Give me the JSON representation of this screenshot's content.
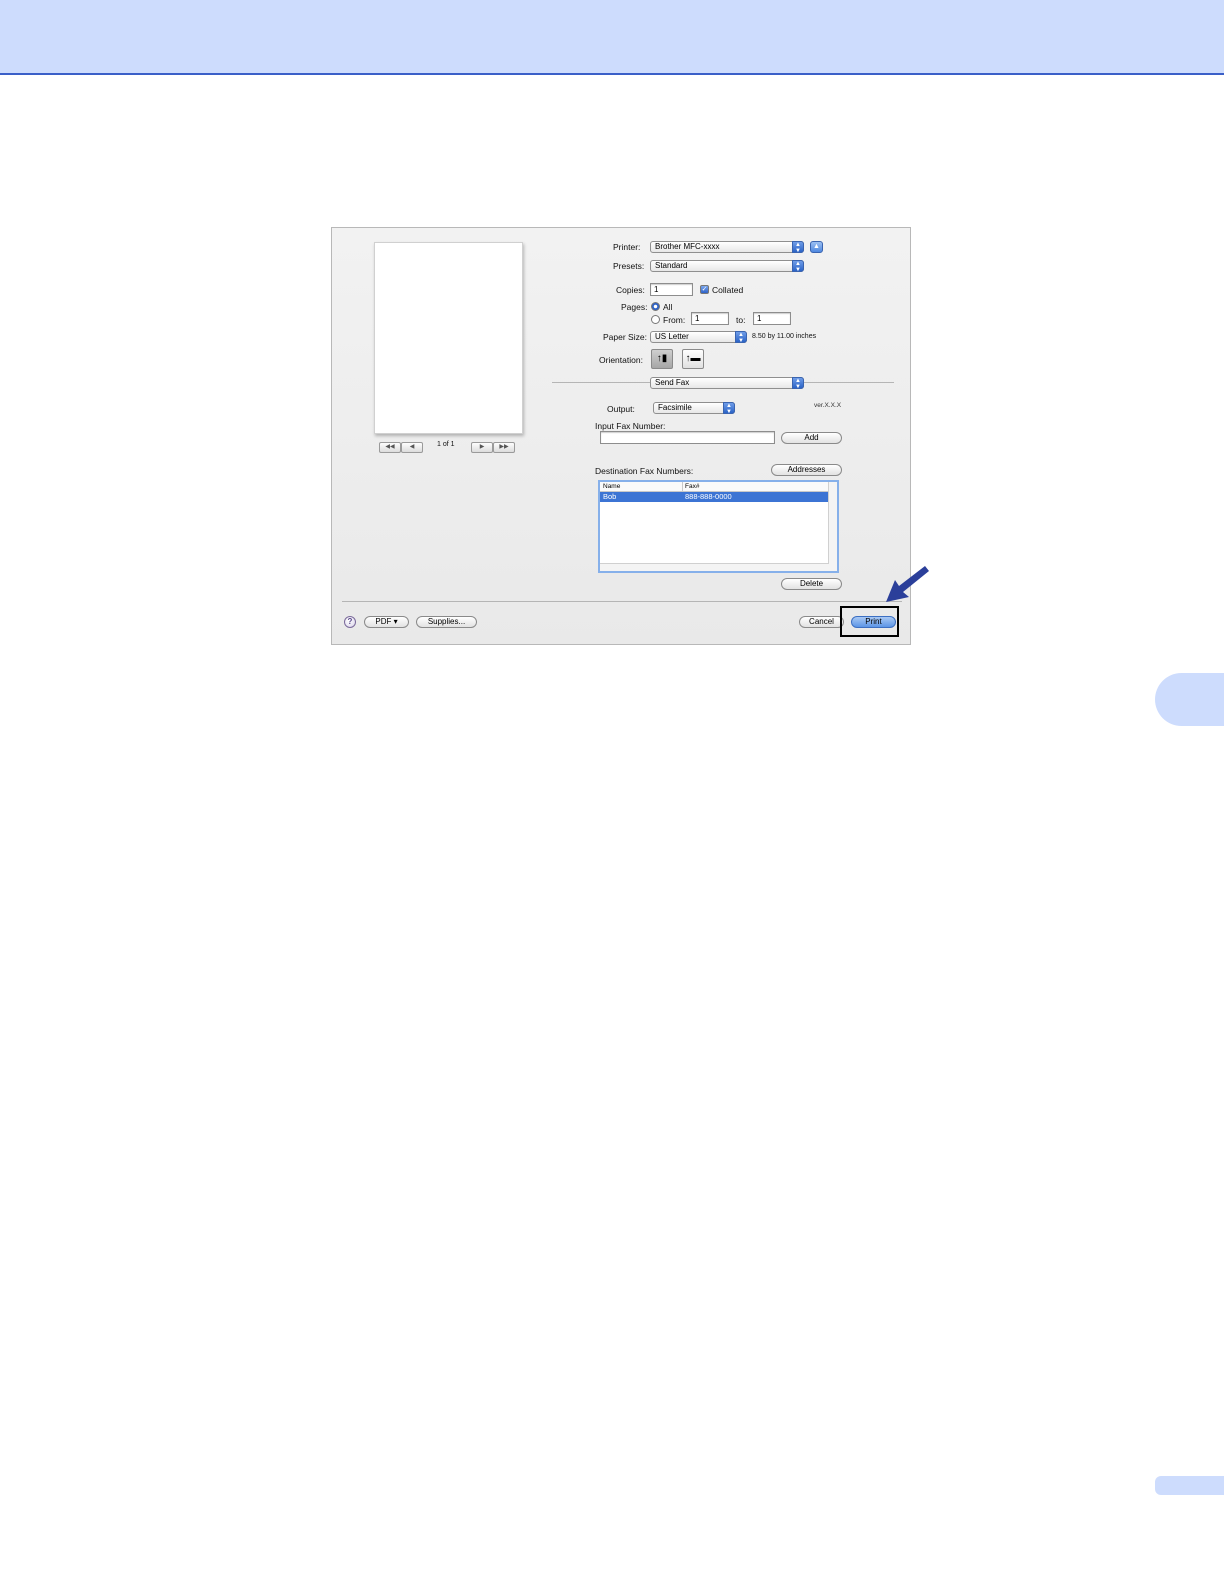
{
  "colors": {
    "banner": "#cddcfd",
    "banner_rule": "#3a5fc8",
    "accent_blue": "#3c74d4",
    "arrow": "#2b3f9a"
  },
  "dialog": {
    "preview": {
      "page_indicator": "1 of 1",
      "nav_first": "◀◀",
      "nav_prev": "◀",
      "nav_next": "▶",
      "nav_last": "▶▶"
    },
    "printer": {
      "label": "Printer:",
      "value": "Brother MFC-xxxx"
    },
    "presets": {
      "label": "Presets:",
      "value": "Standard"
    },
    "copies": {
      "label": "Copies:",
      "value": "1",
      "collated_label": "Collated",
      "collated_checked": true
    },
    "pages": {
      "label": "Pages:",
      "all_label": "All",
      "from_label": "From:",
      "from_value": "1",
      "to_label": "to:",
      "to_value": "1",
      "selected": "All"
    },
    "paper_size": {
      "label": "Paper Size:",
      "value": "US Letter",
      "dimensions": "8.50 by 11.00 inches"
    },
    "orientation": {
      "label": "Orientation:",
      "selected": "portrait"
    },
    "section_popup": "Send Fax",
    "output": {
      "label": "Output:",
      "value": "Facsimile"
    },
    "version": "ver.X.X.X",
    "input_fax": {
      "label": "Input Fax Number:",
      "value": "",
      "add_label": "Add"
    },
    "destination": {
      "label": "Destination Fax Numbers:",
      "addresses_label": "Addresses",
      "columns": [
        "Name",
        "Fax#"
      ],
      "rows": [
        {
          "name": "Bob",
          "fax": "888-888-0000"
        }
      ],
      "delete_label": "Delete"
    },
    "footer": {
      "help_glyph": "?",
      "pdf_label": "PDF ▾",
      "supplies_label": "Supplies...",
      "cancel_label": "Cancel",
      "print_label": "Print"
    }
  }
}
